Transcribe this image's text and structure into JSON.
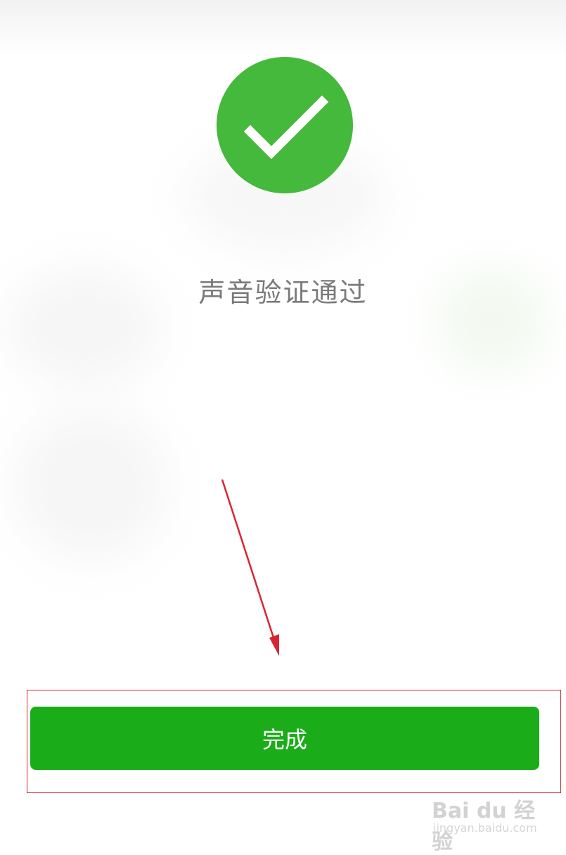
{
  "status": {
    "message": "声音验证通过",
    "icon": "checkmark-circle-icon",
    "color": "#44b93b"
  },
  "action": {
    "done_label": "完成",
    "color": "#1aad19"
  },
  "annotation": {
    "arrow_color": "#d9252f",
    "box_color": "#d9252f"
  },
  "watermark": {
    "logo_text": "Bai du 经验",
    "url_text": "jingyan.baidu.com"
  }
}
